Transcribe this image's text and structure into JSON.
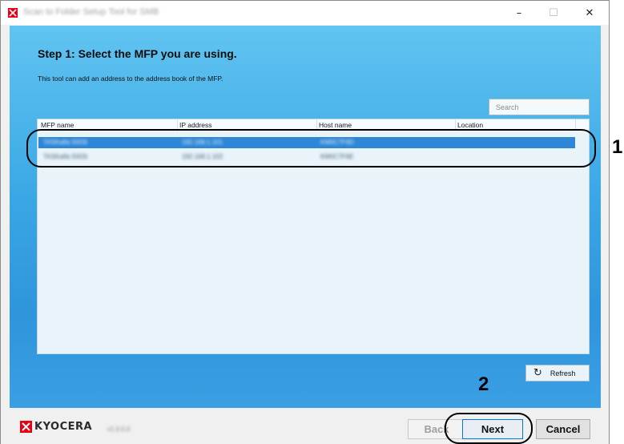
{
  "window": {
    "title": "Scan to Folder Setup Tool for SMB",
    "controls": {
      "minimize": "–",
      "maximize": "☐",
      "close": "✕"
    }
  },
  "step": {
    "title": "Step 1: Select the MFP you are using.",
    "description": "This tool can add an address to the address book of the MFP."
  },
  "search": {
    "placeholder": "Search"
  },
  "mfp_list": {
    "columns": [
      "MFP name",
      "IP address",
      "Host name",
      "Location"
    ],
    "rows": [
      {
        "name": "TASKalfa 5003i",
        "ip": "192.168.1.101",
        "host": "KM0C7F6D",
        "location": "",
        "selected": true
      },
      {
        "name": "TASKalfa 5003i",
        "ip": "192.168.1.102",
        "host": "KM0C7F6E",
        "location": "",
        "selected": false
      }
    ]
  },
  "refresh": {
    "label": "Refresh",
    "icon": "refresh-icon"
  },
  "footer": {
    "brand": "KYOCERA",
    "version": "v1.0.0.0",
    "back_label": "Back",
    "next_label": "Next",
    "cancel_label": "Cancel"
  },
  "annotations": {
    "callout_1": "1",
    "callout_2": "2"
  },
  "colors": {
    "panel_top": "#61c4f1",
    "panel_bottom": "#2f95dc",
    "selected_row": "#2e86d6",
    "brand_red": "#e60012"
  }
}
